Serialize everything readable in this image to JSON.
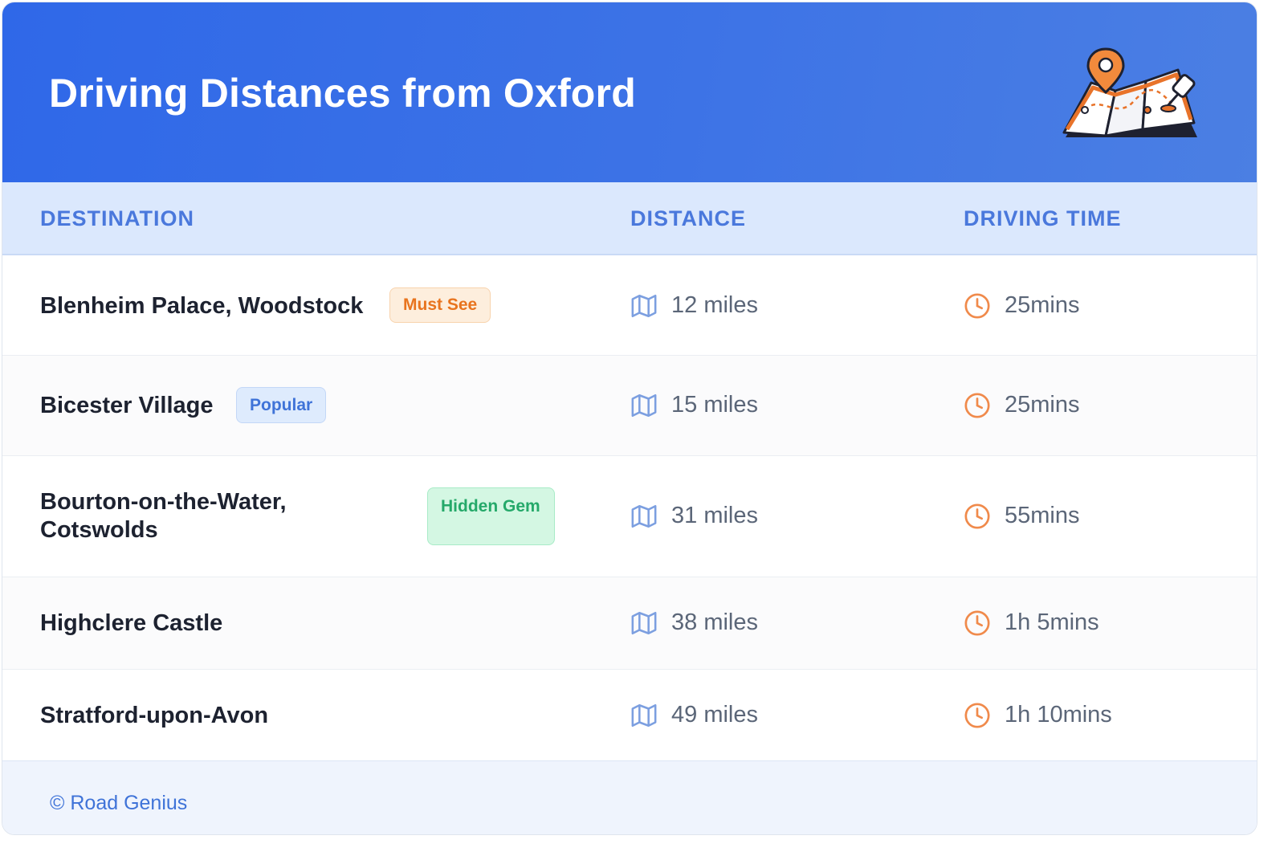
{
  "header": {
    "title": "Driving Distances from Oxford",
    "illustration_icon": "map-with-pins-icon"
  },
  "table": {
    "columns": [
      "DESTINATION",
      "DISTANCE",
      "DRIVING TIME"
    ],
    "distance_icon": "map-icon",
    "time_icon": "clock-icon",
    "rows": [
      {
        "destination": "Blenheim Palace, Woodstock",
        "badge": "Must See",
        "badge_type": "must-see",
        "distance": "12 miles",
        "time": "25mins"
      },
      {
        "destination": "Bicester Village",
        "badge": "Popular",
        "badge_type": "popular",
        "distance": "15 miles",
        "time": "25mins"
      },
      {
        "destination": "Bourton-on-the-Water, Cotswolds",
        "badge": "Hidden Gem",
        "badge_type": "hidden-gem",
        "distance": "31 miles",
        "time": "55mins"
      },
      {
        "destination": "Highclere Castle",
        "badge": "",
        "badge_type": "",
        "distance": "38 miles",
        "time": "1h 5mins"
      },
      {
        "destination": "Stratford-upon-Avon",
        "badge": "",
        "badge_type": "",
        "distance": "49 miles",
        "time": "1h 10mins"
      }
    ]
  },
  "footer": {
    "text": "© Road Genius"
  },
  "colors": {
    "header_start": "#2f68e8",
    "header_end": "#4b7fe3",
    "column_header_text": "#4a78dc",
    "clock_orange": "#f08a4b",
    "map_icon_blue": "#7c9fe0"
  }
}
